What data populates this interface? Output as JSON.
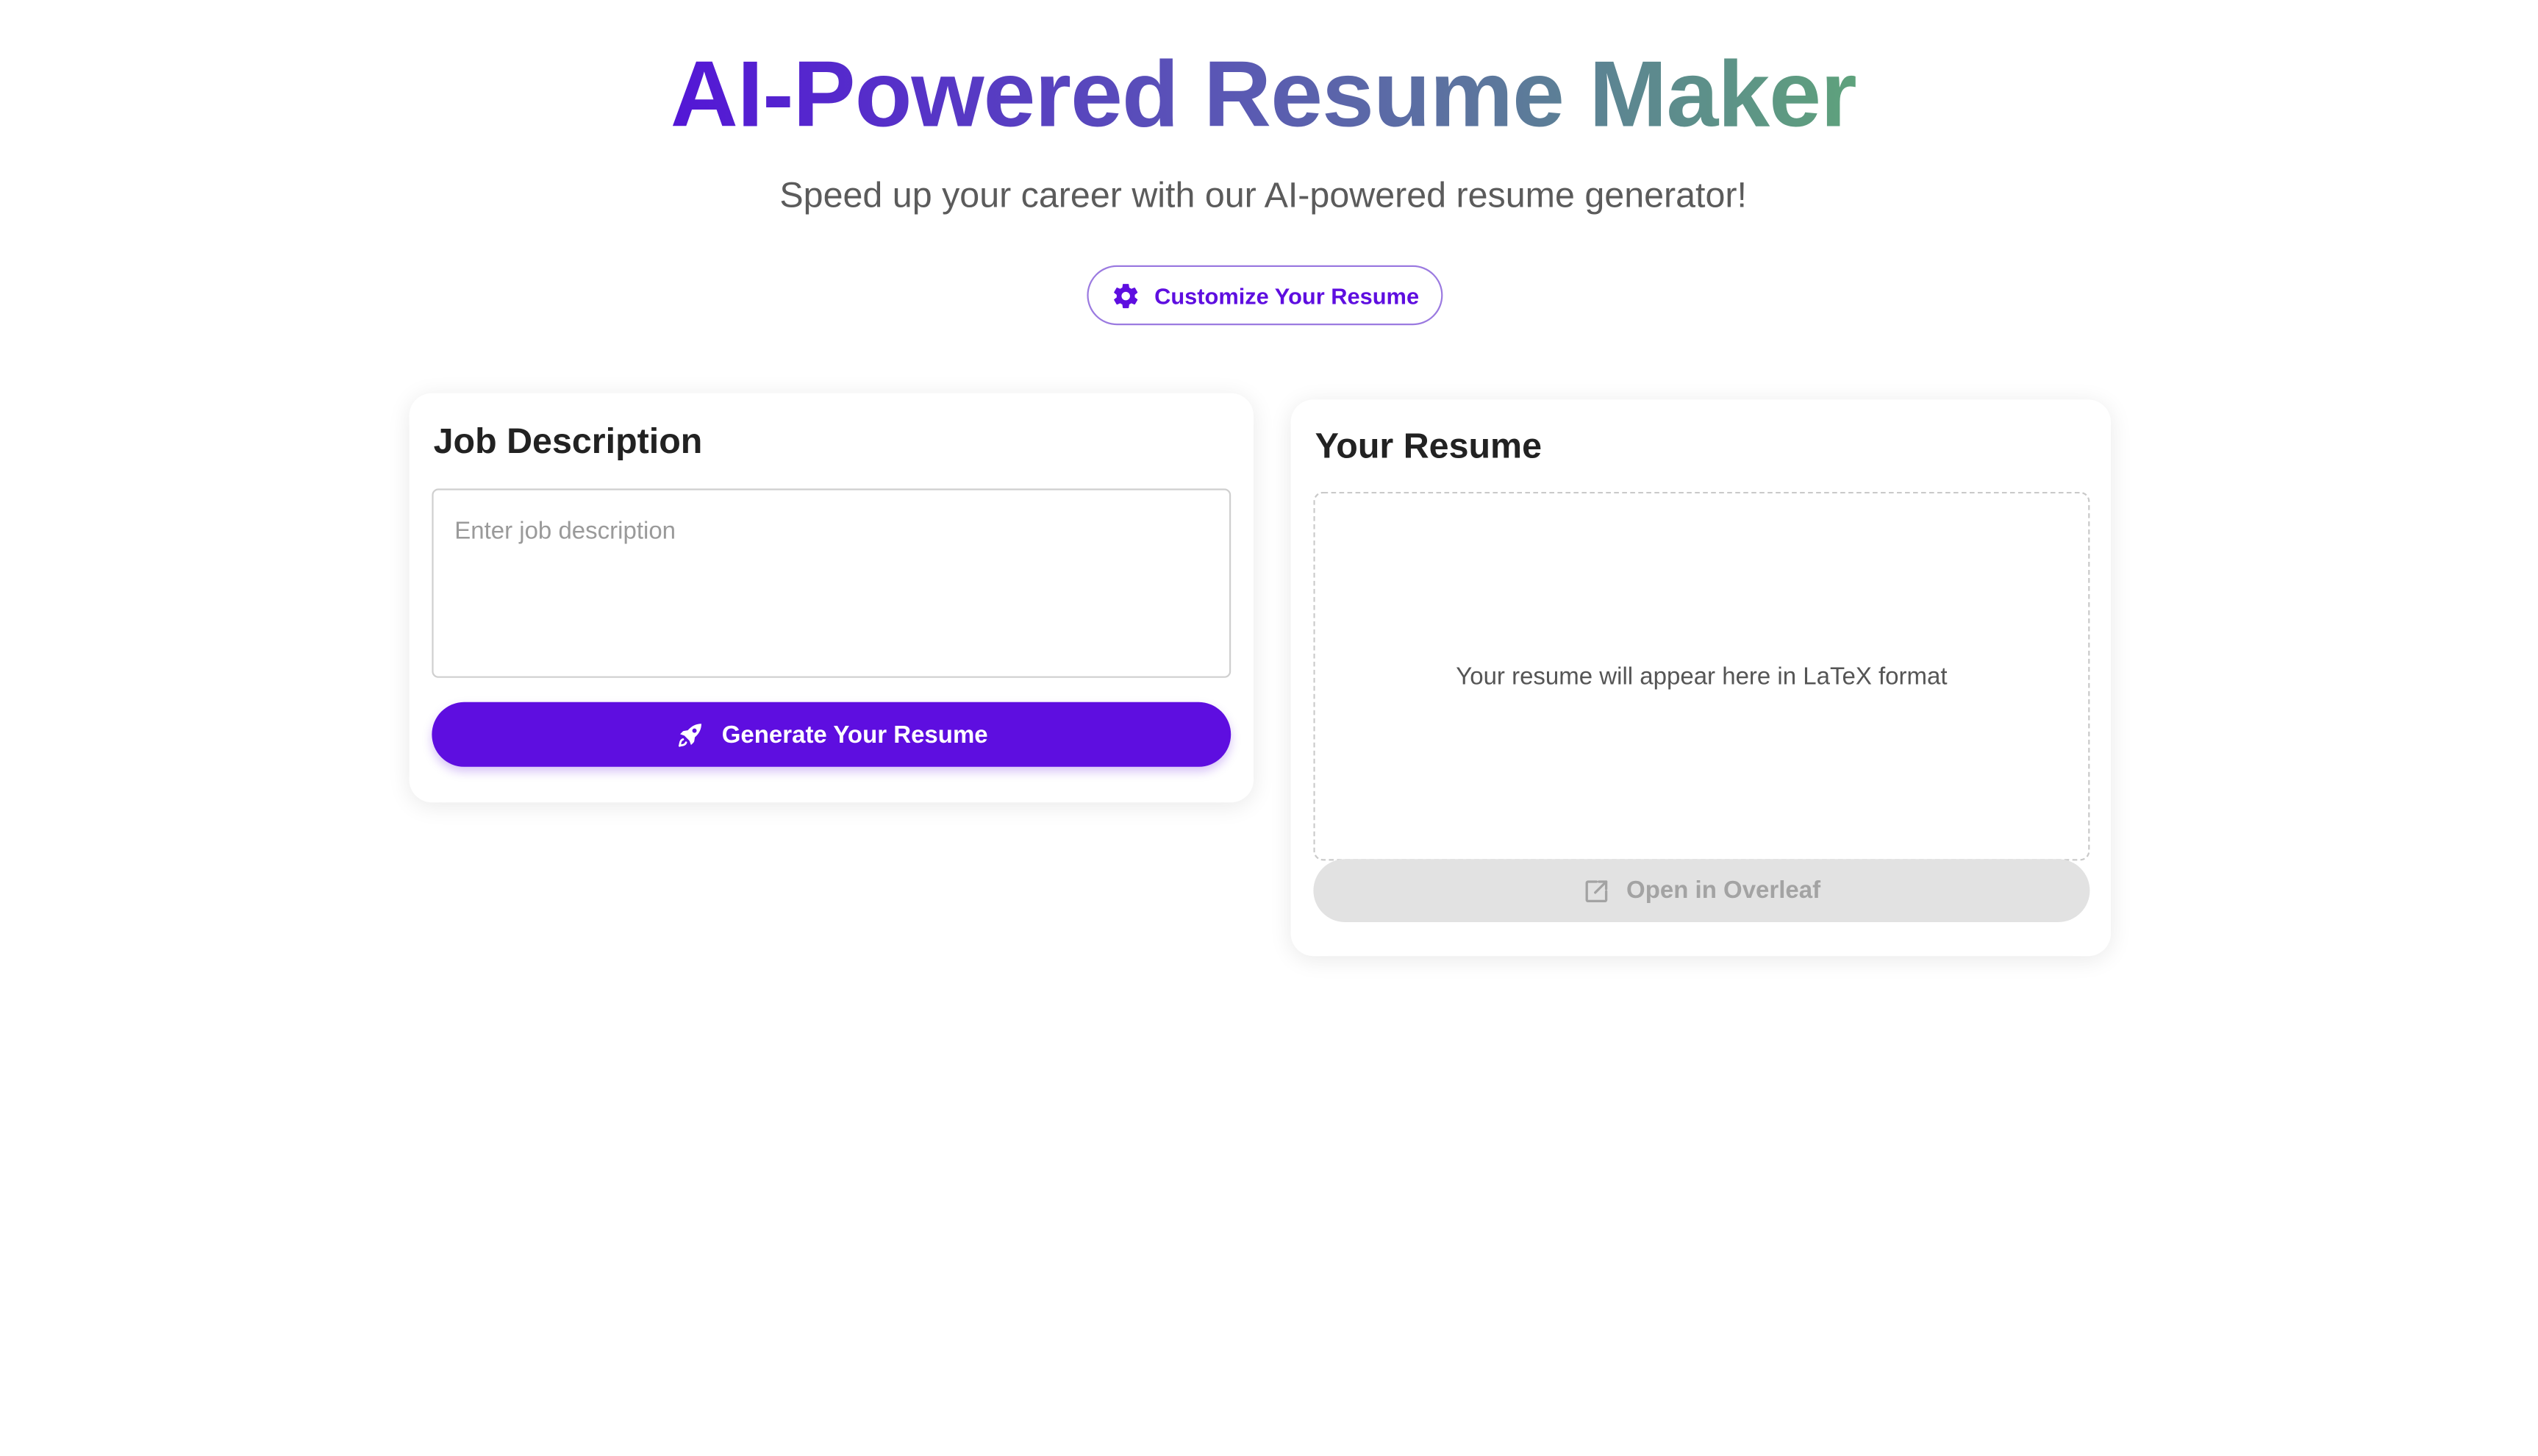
{
  "header": {
    "title": "AI-Powered Resume Maker",
    "subtitle": "Speed up your career with our AI-powered resume generator!",
    "customize_label": "Customize Your Resume",
    "customize_icon": "gear-icon"
  },
  "job_panel": {
    "heading": "Job Description",
    "textarea_value": "",
    "textarea_placeholder": "Enter job description",
    "generate_label": "Generate Your Resume",
    "generate_icon": "rocket-icon"
  },
  "resume_panel": {
    "heading": "Your Resume",
    "placeholder_text": "Your resume will appear here in LaTeX format",
    "overleaf_label": "Open in Overleaf",
    "overleaf_icon": "external-link-icon",
    "overleaf_enabled": false
  },
  "colors": {
    "accent": "#5e0ee0",
    "title_gradient_start": "#5316d6",
    "title_gradient_end": "#5ea27c",
    "disabled_bg": "#e2e2e2",
    "disabled_text": "#a3a3a3"
  }
}
